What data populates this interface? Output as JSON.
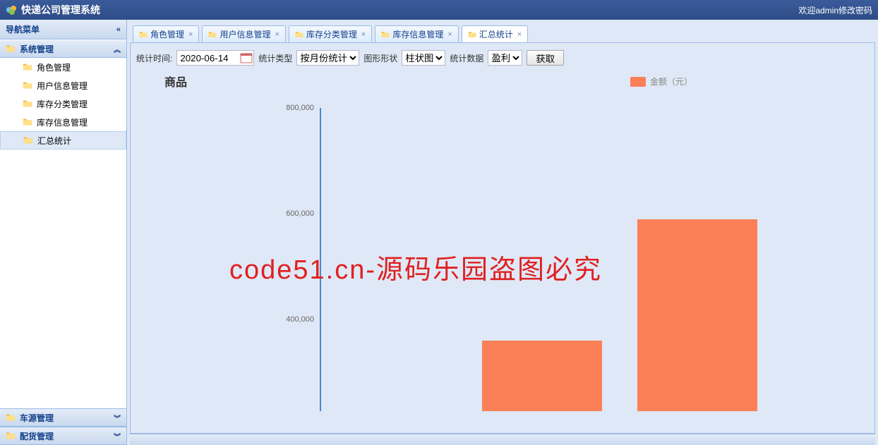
{
  "app": {
    "title": "快递公司管理系统",
    "welcome": "欢迎admin修改密码"
  },
  "sidebar": {
    "header": "导航菜单",
    "sections": [
      {
        "title": "系统管理",
        "expanded": true,
        "items": [
          {
            "label": "角色管理"
          },
          {
            "label": "用户信息管理"
          },
          {
            "label": "库存分类管理"
          },
          {
            "label": "库存信息管理"
          },
          {
            "label": "汇总统计",
            "selected": true
          }
        ]
      },
      {
        "title": "车源管理",
        "expanded": false
      },
      {
        "title": "配货管理",
        "expanded": false
      }
    ]
  },
  "tabs": [
    {
      "label": "角色管理",
      "closable": true
    },
    {
      "label": "用户信息管理",
      "closable": true
    },
    {
      "label": "库存分类管理",
      "closable": true
    },
    {
      "label": "库存信息管理",
      "closable": true
    },
    {
      "label": "汇总统计",
      "closable": true,
      "active": true
    }
  ],
  "toolbar": {
    "time_label": "统计时间:",
    "time_value": "2020-06-14",
    "type_label": "统计类型",
    "type_value": "按月份统计",
    "shape_label": "图形形状",
    "shape_value": "柱状图",
    "data_label": "统计数据",
    "data_value": "盈利",
    "fetch_label": "获取"
  },
  "chart_data": {
    "type": "bar",
    "title": "商品",
    "legend": "金额（元）",
    "ylabel": "",
    "ylim": [
      200000,
      800000
    ],
    "yticks": [
      800000,
      600000,
      400000
    ],
    "ytick_labels": [
      "800,000",
      "600,000",
      "400,000"
    ],
    "categories": [
      "",
      ""
    ],
    "values": [
      340000,
      580000
    ],
    "bar_color": "#fb8057"
  },
  "watermark": "code51.cn-源码乐园盗图必究"
}
